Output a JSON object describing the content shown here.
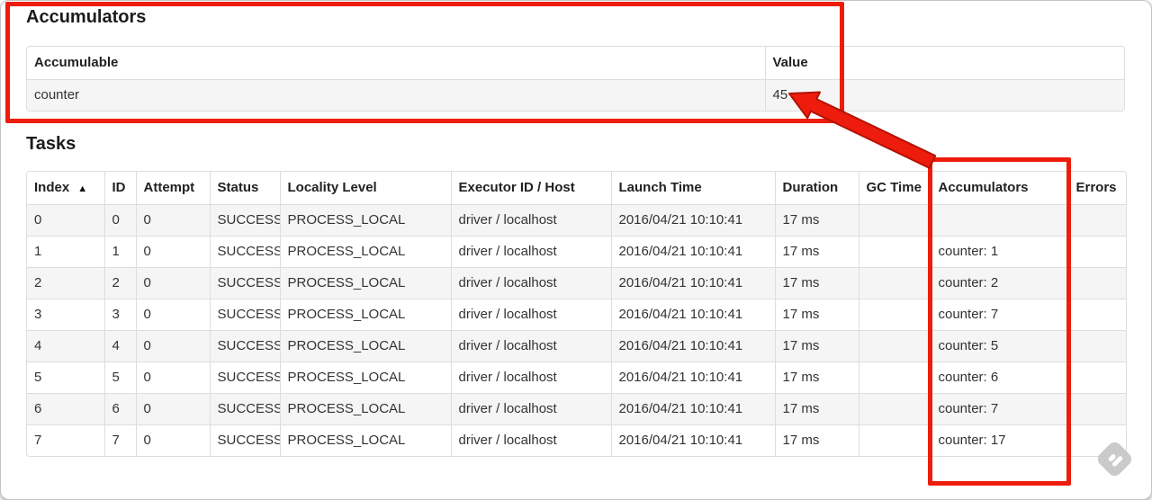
{
  "annotation_color": "#ee1c0c",
  "accumulators_section": {
    "title": "Accumulators",
    "table": {
      "headers": [
        {
          "label": "Accumulable"
        },
        {
          "label": "Value"
        }
      ],
      "rows": [
        [
          "counter",
          "45"
        ]
      ]
    }
  },
  "tasks_section": {
    "title": "Tasks",
    "table": {
      "headers": [
        {
          "label": "Index",
          "sort": "▲"
        },
        {
          "label": "ID"
        },
        {
          "label": "Attempt"
        },
        {
          "label": "Status"
        },
        {
          "label": "Locality Level"
        },
        {
          "label": "Executor ID / Host"
        },
        {
          "label": "Launch Time"
        },
        {
          "label": "Duration"
        },
        {
          "label": "GC Time"
        },
        {
          "label": "Accumulators"
        },
        {
          "label": "Errors"
        }
      ],
      "rows": [
        [
          "0",
          "0",
          "0",
          "SUCCESS",
          "PROCESS_LOCAL",
          "driver / localhost",
          "2016/04/21 10:10:41",
          "17 ms",
          "",
          "",
          ""
        ],
        [
          "1",
          "1",
          "0",
          "SUCCESS",
          "PROCESS_LOCAL",
          "driver / localhost",
          "2016/04/21 10:10:41",
          "17 ms",
          "",
          "counter: 1",
          ""
        ],
        [
          "2",
          "2",
          "0",
          "SUCCESS",
          "PROCESS_LOCAL",
          "driver / localhost",
          "2016/04/21 10:10:41",
          "17 ms",
          "",
          "counter: 2",
          ""
        ],
        [
          "3",
          "3",
          "0",
          "SUCCESS",
          "PROCESS_LOCAL",
          "driver / localhost",
          "2016/04/21 10:10:41",
          "17 ms",
          "",
          "counter: 7",
          ""
        ],
        [
          "4",
          "4",
          "0",
          "SUCCESS",
          "PROCESS_LOCAL",
          "driver / localhost",
          "2016/04/21 10:10:41",
          "17 ms",
          "",
          "counter: 5",
          ""
        ],
        [
          "5",
          "5",
          "0",
          "SUCCESS",
          "PROCESS_LOCAL",
          "driver / localhost",
          "2016/04/21 10:10:41",
          "17 ms",
          "",
          "counter: 6",
          ""
        ],
        [
          "6",
          "6",
          "0",
          "SUCCESS",
          "PROCESS_LOCAL",
          "driver / localhost",
          "2016/04/21 10:10:41",
          "17 ms",
          "",
          "counter: 7",
          ""
        ],
        [
          "7",
          "7",
          "0",
          "SUCCESS",
          "PROCESS_LOCAL",
          "driver / localhost",
          "2016/04/21 10:10:41",
          "17 ms",
          "",
          "counter: 17",
          ""
        ]
      ]
    }
  }
}
